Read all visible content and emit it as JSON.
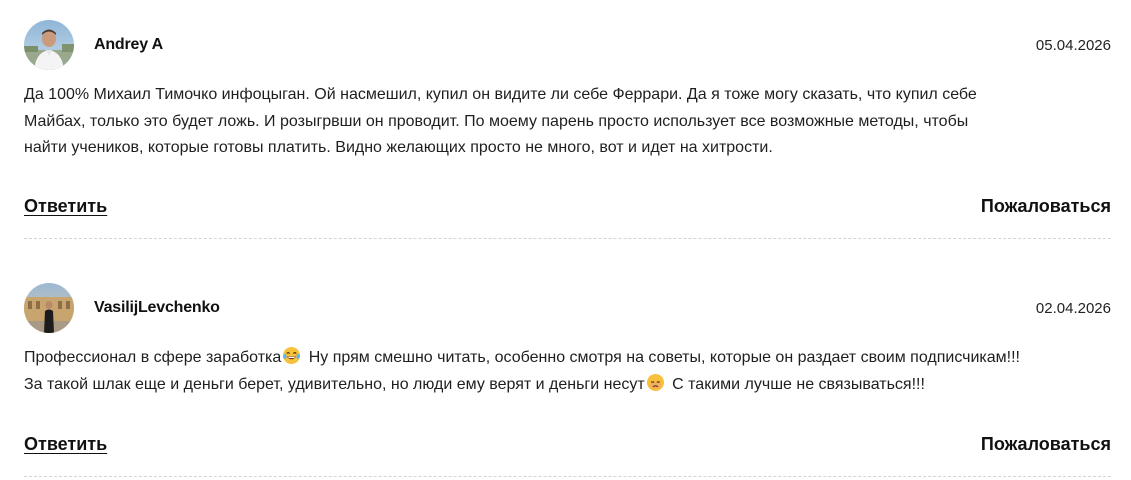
{
  "comments": [
    {
      "author": "Andrey A",
      "date": "05.04.2026",
      "avatar_icon": "user-photo-avatar",
      "text_lines": [
        "Да 100% Михаил Тимочко инфоцыган. Ой насмешил, купил он видите ли себе Феррари. Да я тоже могу сказать, что купил себе",
        "Майбах, только это будет ложь. И розыгрвши он проводит. По моему парень просто использует все возможные методы, чтобы",
        "найти учеников, которые готовы платить. Видно желающих просто не много, вот и идет на хитрости."
      ],
      "reply_label": "Ответить",
      "report_label": "Пожаловаться"
    },
    {
      "author": "VasilijLevchenko",
      "date": "02.04.2026",
      "avatar_icon": "user-photo-avatar",
      "text_line1_a": "Профессионал в сфере заработка",
      "text_line1_b": " Ну прям смешно читать, особенно смотря на советы, которые он раздает своим подписчикам!!!",
      "text_line2_a": "За такой шлак еще и деньги берет, удивительно, но люди ему верят и деньги несут",
      "text_line2_b": " С такими лучше не связываться!!!",
      "emojis": [
        "laughing-tears-emoji",
        "sad-emoji"
      ],
      "reply_label": "Ответить",
      "report_label": "Пожаловаться"
    }
  ],
  "colors": {
    "text": "#1f1f1f",
    "divider": "#d4d4d4",
    "background": "#ffffff"
  }
}
